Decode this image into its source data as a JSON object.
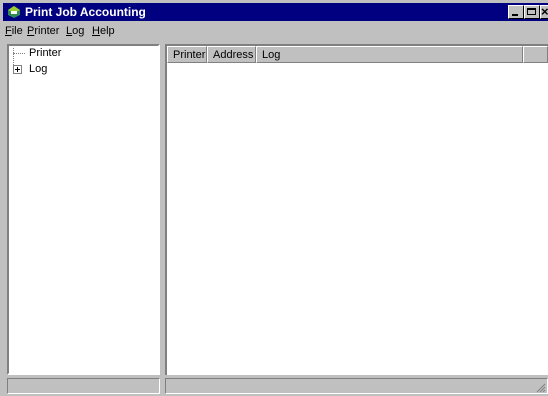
{
  "window": {
    "title": "Print Job Accounting",
    "title_icon": "printer-app-icon",
    "close_glyph": "×"
  },
  "menu": {
    "items": [
      {
        "accel": "F",
        "rest": "ile"
      },
      {
        "accel": "P",
        "rest": "rinter"
      },
      {
        "accel": "L",
        "rest": "og"
      },
      {
        "accel": "H",
        "rest": "elp"
      }
    ]
  },
  "tree": {
    "nodes": [
      {
        "label": "Printer",
        "expandable": false
      },
      {
        "label": "Log",
        "expandable": true
      }
    ]
  },
  "list": {
    "columns": [
      "Printer",
      "Address",
      "Log",
      ""
    ],
    "rows": []
  },
  "status": {
    "panel1": "",
    "panel2": ""
  },
  "colors": {
    "titlebar": "#000080",
    "face": "#c0c0c0"
  }
}
